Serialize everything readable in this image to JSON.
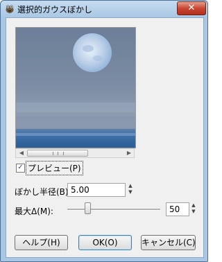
{
  "window": {
    "title": "選択的ガウスぼかし",
    "close_symbol": "✕",
    "app_icon": "gimp-wilber-icon"
  },
  "preview": {
    "image": "moonlit-sea-photo",
    "checkbox_checked": true,
    "checkbox_glyph": "✓",
    "label": "プレビュー(P)"
  },
  "scrollbar": {
    "left_arrow": "◀",
    "right_arrow": "▶"
  },
  "blur_radius": {
    "label": "ぼかし半径(B):",
    "value": "5.00"
  },
  "max_delta": {
    "label": "最大Δ(M):",
    "value": "50",
    "slider_fraction": 0.2
  },
  "spin": {
    "up": "▲",
    "down": "▼"
  },
  "buttons": {
    "help": "ヘルプ(H)",
    "ok": "OK(O)",
    "cancel": "キャンセル(C)"
  }
}
